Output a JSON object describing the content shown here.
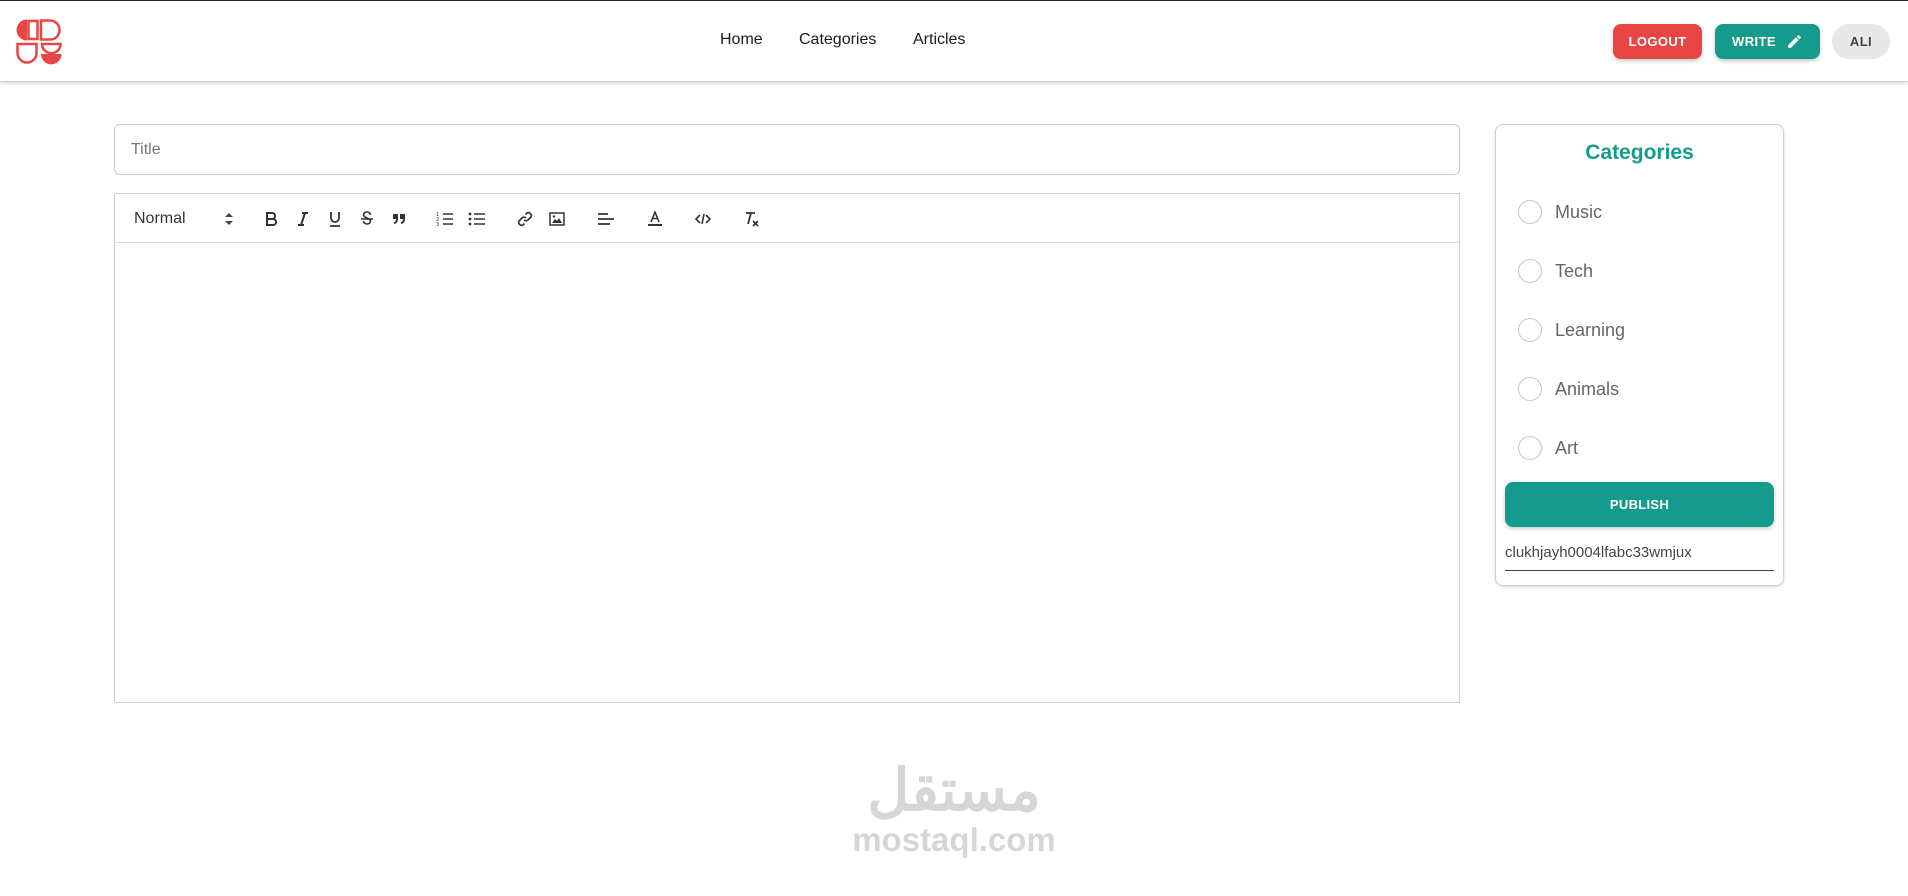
{
  "nav": {
    "links": [
      "Home",
      "Categories",
      "Articles"
    ],
    "logout_label": "LOGOUT",
    "write_label": "WRITE",
    "user_label": "ALI"
  },
  "editor": {
    "title_placeholder": "Title",
    "format_select": "Normal",
    "toolbar_icons": [
      "bold-icon",
      "italic-icon",
      "underline-icon",
      "strikethrough-icon",
      "blockquote-icon",
      "ordered-list-icon",
      "bullet-list-icon",
      "link-icon",
      "image-icon",
      "align-icon",
      "text-color-icon",
      "code-icon",
      "clear-format-icon"
    ]
  },
  "categories_panel": {
    "title": "Categories",
    "items": [
      "Music",
      "Tech",
      "Learning",
      "Animals",
      "Art"
    ],
    "publish_label": "PUBLISH",
    "id_value": "clukhjayh0004lfabc33wmjux"
  },
  "watermark": {
    "arabic": "مستقل",
    "latin": "mostaql.com"
  },
  "colors": {
    "accent": "#159b8c",
    "danger": "#e84545"
  }
}
